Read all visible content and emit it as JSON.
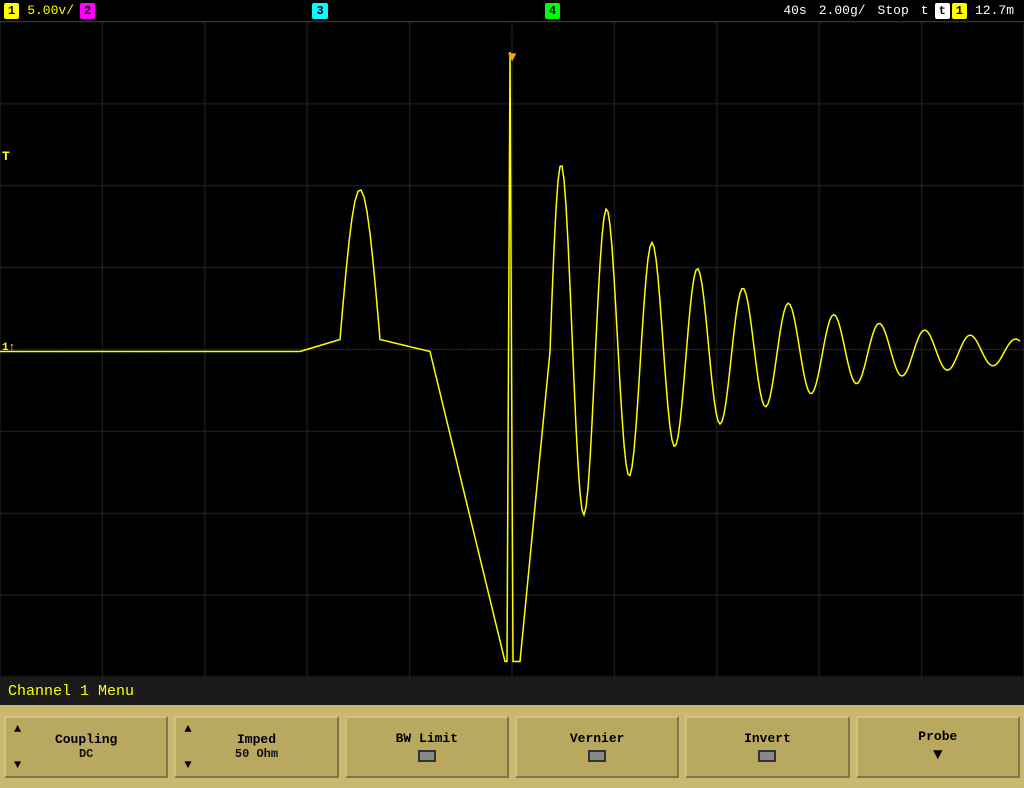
{
  "header": {
    "ch1_badge": "1",
    "ch1_value": "5.00v/",
    "ch2_badge": "2",
    "ch3_badge": "3",
    "ch4_badge": "4",
    "timebase_value": "40s",
    "timebase_div": "2.00g/",
    "stop_label": "Stop",
    "trig_badge": "t",
    "ch1_badge2": "1",
    "trig_value": "12.7m"
  },
  "screen": {
    "ch1_marker": "T",
    "ch1_ground": "1↑"
  },
  "menu": {
    "title": "Channel 1  Menu",
    "btn_coupling_label": "Coupling",
    "btn_coupling_value": "DC",
    "btn_imped_label": "Imped",
    "btn_imped_value": "50 Ohm",
    "btn_bwlimit_label": "BW Limit",
    "btn_vernier_label": "Vernier",
    "btn_invert_label": "Invert",
    "btn_probe_label": "Probe",
    "probe_arrow": "▼"
  },
  "colors": {
    "waveform": "#ffff00",
    "grid": "#333333",
    "background": "#000000",
    "menu_bg": "#c8b870",
    "header_bg": "#000000"
  }
}
